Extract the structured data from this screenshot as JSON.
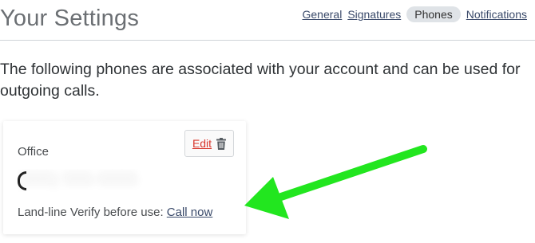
{
  "header": {
    "title": "Your Settings",
    "tabs": [
      {
        "label": "General",
        "active": false
      },
      {
        "label": "Signatures",
        "active": false
      },
      {
        "label": "Phones",
        "active": true
      },
      {
        "label": "Notifications",
        "active": false
      }
    ]
  },
  "intro": {
    "text": "The following phones are associated with your account and can be used for outgoing calls."
  },
  "phone_card": {
    "label": "Office",
    "number": "(555) 555-5555",
    "edit_label": "Edit",
    "line_type": "Land-line",
    "verify_text": "Verify before use:",
    "call_label": "Call now"
  },
  "icons": {
    "delete": "trash-icon",
    "annotation": "arrow-icon"
  },
  "colors": {
    "edit_link": "#d8352b",
    "link": "#3a4a6a",
    "active_tab_bg": "#dfe3e7",
    "annotation_arrow": "#22e61f"
  }
}
